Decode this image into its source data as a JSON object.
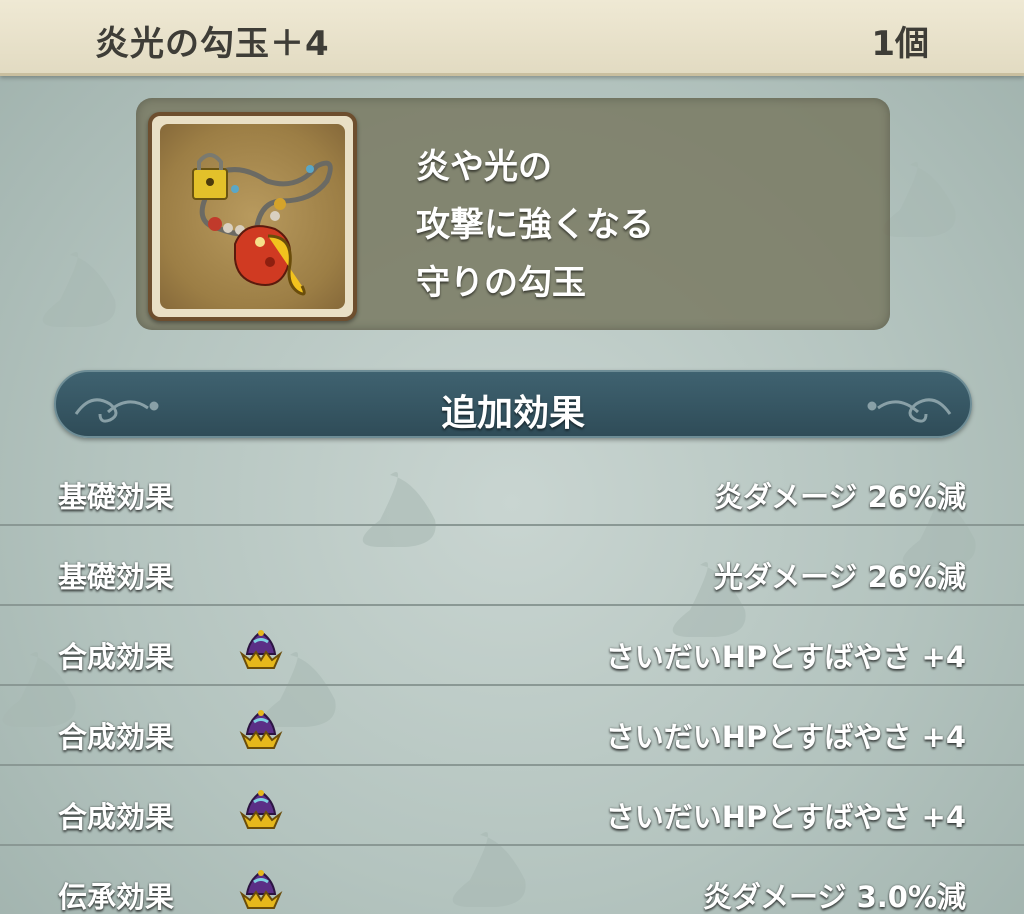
{
  "header": {
    "item_name": "炎光の勾玉＋4",
    "item_count": "1個"
  },
  "item": {
    "icon": "magatama-necklace-icon",
    "description_lines": [
      "炎や光の",
      "攻撃に強くなる",
      "守りの勾玉"
    ]
  },
  "section": {
    "title": "追加効果"
  },
  "effects": [
    {
      "type": "基礎効果",
      "icon": null,
      "value": "炎ダメージ  26%減"
    },
    {
      "type": "基礎効果",
      "icon": null,
      "value": "光ダメージ  26%減"
    },
    {
      "type": "合成効果",
      "icon": "crown-icon",
      "value": "さいだいHPとすばやさ  +4"
    },
    {
      "type": "合成効果",
      "icon": "crown-icon",
      "value": "さいだいHPとすばやさ  +4"
    },
    {
      "type": "合成効果",
      "icon": "crown-icon",
      "value": "さいだいHPとすばやさ  +4"
    },
    {
      "type": "伝承効果",
      "icon": "crown-icon",
      "value": "炎ダメージ  3.0%減"
    }
  ],
  "colors": {
    "header_bg": "#e8e2ca",
    "header_text": "#3e3d37",
    "panel_bg": "#76765e",
    "section_bar": "#365664",
    "crown_gold": "#e6b81c",
    "crown_purple": "#5b2f86"
  }
}
